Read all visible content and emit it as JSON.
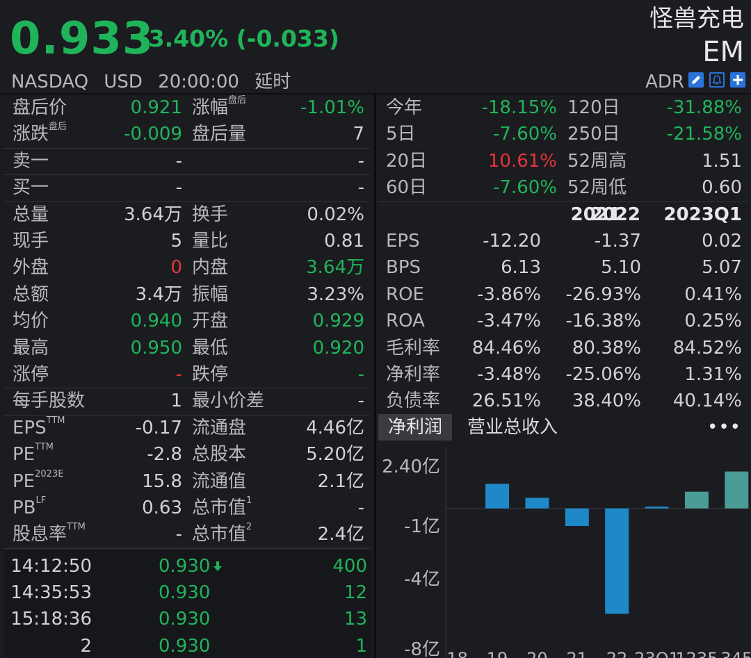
{
  "quote": {
    "price": "0.933",
    "change": "-3.40% (-0.033)",
    "name": "怪兽充电",
    "code": "EM",
    "exchange": "NASDAQ",
    "currency": "USD",
    "time": "20:00:00",
    "delay": "延时",
    "adr": "ADR"
  },
  "left_rows": [
    {
      "l1": "盘后价",
      "sup1": "",
      "v1": "0.921",
      "c1": "g",
      "l2": "涨幅",
      "sup2": "盘后",
      "v2": "-1.01%",
      "c2": "g"
    },
    {
      "l1": "涨跌",
      "sup1": "盘后",
      "v1": "-0.009",
      "c1": "g",
      "l2": "盘后量",
      "sup2": "",
      "v2": "7",
      "c2": ""
    },
    {
      "l1": "卖一",
      "sup1": "",
      "v1": "-",
      "c1": "",
      "l2": "",
      "sup2": "",
      "v2": "-",
      "c2": ""
    },
    {
      "l1": "买一",
      "sup1": "",
      "v1": "-",
      "c1": "",
      "l2": "",
      "sup2": "",
      "v2": "-",
      "c2": ""
    },
    {
      "l1": "总量",
      "sup1": "",
      "v1": "3.64万",
      "c1": "",
      "l2": "换手",
      "sup2": "",
      "v2": "0.02%",
      "c2": ""
    },
    {
      "l1": "现手",
      "sup1": "",
      "v1": "5",
      "c1": "",
      "l2": "量比",
      "sup2": "",
      "v2": "0.81",
      "c2": ""
    },
    {
      "l1": "外盘",
      "sup1": "",
      "v1": "0",
      "c1": "r",
      "l2": "内盘",
      "sup2": "",
      "v2": "3.64万",
      "c2": "g"
    },
    {
      "l1": "总额",
      "sup1": "",
      "v1": "3.4万",
      "c1": "",
      "l2": "振幅",
      "sup2": "",
      "v2": "3.23%",
      "c2": ""
    },
    {
      "l1": "均价",
      "sup1": "",
      "v1": "0.940",
      "c1": "g",
      "l2": "开盘",
      "sup2": "",
      "v2": "0.929",
      "c2": "g"
    },
    {
      "l1": "最高",
      "sup1": "",
      "v1": "0.950",
      "c1": "g",
      "l2": "最低",
      "sup2": "",
      "v2": "0.920",
      "c2": "g"
    },
    {
      "l1": "涨停",
      "sup1": "",
      "v1": "-",
      "c1": "r",
      "l2": "跌停",
      "sup2": "",
      "v2": "-",
      "c2": "g"
    },
    {
      "l1": "每手股数",
      "sup1": "",
      "v1": "1",
      "c1": "",
      "l2": "最小价差",
      "sup2": "",
      "v2": "-",
      "c2": ""
    },
    {
      "l1": "EPS",
      "sup1": "TTM",
      "v1": "-0.17",
      "c1": "",
      "l2": "流通盘",
      "sup2": "",
      "v2": "4.46亿",
      "c2": ""
    },
    {
      "l1": "PE",
      "sup1": "TTM",
      "v1": "-2.8",
      "c1": "",
      "l2": "总股本",
      "sup2": "",
      "v2": "5.20亿",
      "c2": ""
    },
    {
      "l1": "PE",
      "sup1": "2023E",
      "v1": "15.8",
      "c1": "",
      "l2": "流通值",
      "sup2": "",
      "v2": "2.1亿",
      "c2": ""
    },
    {
      "l1": "PB",
      "sup1": "LF",
      "v1": "0.63",
      "c1": "",
      "l2": "总市值",
      "sup2": "1",
      "v2": "-",
      "c2": ""
    },
    {
      "l1": "股息率",
      "sup1": "TTM",
      "v1": "-",
      "c1": "",
      "l2": "总市值",
      "sup2": "2",
      "v2": "2.4亿",
      "c2": ""
    }
  ],
  "ticks": [
    {
      "time": "14:12:50",
      "price": "0.930",
      "arrow": "down",
      "vol": "400"
    },
    {
      "time": "14:35:53",
      "price": "0.930",
      "arrow": "",
      "vol": "12"
    },
    {
      "time": "15:18:36",
      "price": "0.930",
      "arrow": "",
      "vol": "13"
    },
    {
      "time": "2",
      "price": "0.930",
      "arrow": "",
      "vol": "1"
    }
  ],
  "perf_rows": [
    {
      "l1": "今年",
      "v1": "-18.15%",
      "c1": "g",
      "l2": "120日",
      "v2": "-31.88%",
      "c2": "g"
    },
    {
      "l1": "5日",
      "v1": "-7.60%",
      "c1": "g",
      "l2": "250日",
      "v2": "-21.58%",
      "c2": "g"
    },
    {
      "l1": "20日",
      "v1": "10.61%",
      "c1": "r",
      "l2": "52周高",
      "v2": "1.51",
      "c2": ""
    },
    {
      "l1": "60日",
      "v1": "-7.60%",
      "c1": "g",
      "l2": "52周低",
      "v2": "0.60",
      "c2": ""
    }
  ],
  "fin_headers": [
    "2021",
    "2022",
    "2023Q1"
  ],
  "fin_rows": [
    {
      "label": "EPS",
      "vals": [
        "-12.20",
        "-1.37",
        "0.02"
      ]
    },
    {
      "label": "BPS",
      "vals": [
        "6.13",
        "5.10",
        "5.07"
      ]
    },
    {
      "label": "ROE",
      "vals": [
        "-3.86%",
        "-26.93%",
        "0.41%"
      ]
    },
    {
      "label": "ROA",
      "vals": [
        "-3.47%",
        "-16.38%",
        "0.25%"
      ]
    },
    {
      "label": "毛利率",
      "vals": [
        "84.46%",
        "80.38%",
        "84.52%"
      ]
    },
    {
      "label": "净利率",
      "vals": [
        "-3.48%",
        "-25.06%",
        "1.31%"
      ]
    },
    {
      "label": "负债率",
      "vals": [
        "26.51%",
        "38.40%",
        "40.14%"
      ]
    }
  ],
  "tabs": {
    "active": "净利润",
    "other": "营业总收入",
    "more": "•••"
  },
  "colors": {
    "bg": "#1b1c20",
    "green": "#20b45a",
    "red": "#e5343c",
    "accent": "#2a73d9",
    "bar_neg": "#1e88c8",
    "bar_pos": "#4a9c96"
  },
  "icons": {
    "edit": "pencil-icon",
    "alert": "bell-icon",
    "add": "plus-icon"
  },
  "chart_data": {
    "type": "bar",
    "categories": [
      "18",
      "19",
      "20",
      "21",
      "22",
      "23Q1",
      "1235",
      "345"
    ],
    "x_tick_labels": [
      "18",
      "19",
      "20",
      "21",
      "22",
      "23Q1",
      "1235",
      "345"
    ],
    "values": [
      null,
      1.4,
      0.6,
      -1.0,
      -6.0,
      0.1,
      0.95,
      2.1
    ],
    "yticks": [
      "2.40亿",
      "-1亿",
      "-4亿",
      "-8亿"
    ],
    "ytick_values": [
      2.4,
      -1,
      -4,
      -8
    ],
    "ylim": [
      -8,
      2.4
    ],
    "unit": "亿"
  }
}
